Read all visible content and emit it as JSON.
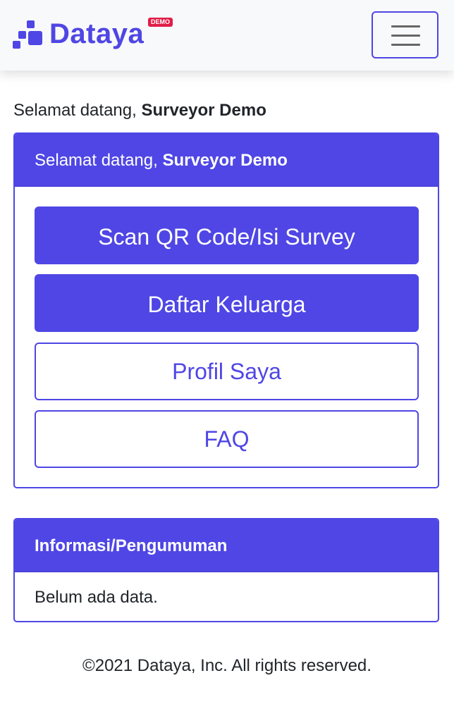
{
  "navbar": {
    "brand_name": "Dataya",
    "brand_badge": "DEMO",
    "menu_toggle_icon": "hamburger-icon",
    "brand_color": "#4f46e5",
    "badge_color": "#e11d48"
  },
  "greeting": {
    "prefix": "Selamat datang, ",
    "user": "Surveyor Demo"
  },
  "main_card": {
    "header_prefix": "Selamat datang, ",
    "header_user": "Surveyor Demo",
    "buttons": [
      {
        "label": "Scan QR Code/Isi Survey",
        "style": "primary"
      },
      {
        "label": "Daftar Keluarga",
        "style": "primary"
      },
      {
        "label": "Profil Saya",
        "style": "outline"
      },
      {
        "label": "FAQ",
        "style": "outline"
      }
    ]
  },
  "info_card": {
    "header": "Informasi/Pengumuman",
    "body": "Belum ada data."
  },
  "footer": {
    "copyright": "©2021 Dataya, Inc. All rights reserved."
  },
  "colors": {
    "accent": "#4f46e5",
    "navbar_bg": "#f8f9fa",
    "text": "#212529"
  }
}
